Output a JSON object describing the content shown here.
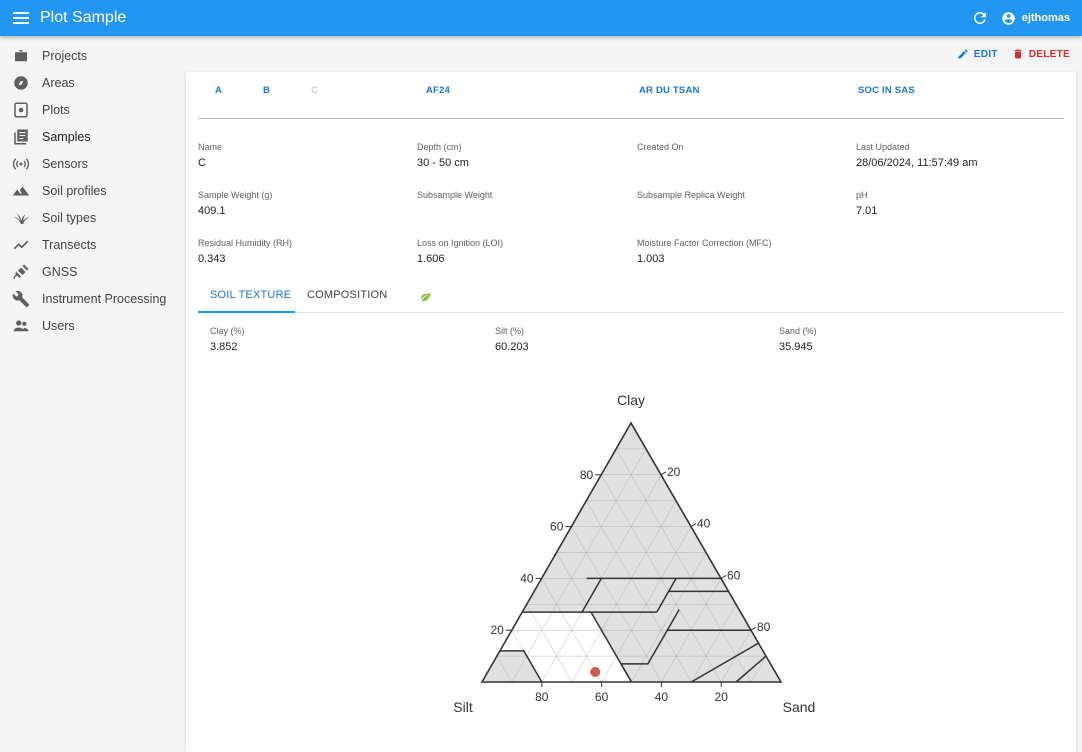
{
  "appbar": {
    "title": "Plot Sample",
    "user": "ejthomas"
  },
  "sidebar": {
    "items": [
      {
        "label": "Projects",
        "icon": "briefcase-icon"
      },
      {
        "label": "Areas",
        "icon": "compass-icon"
      },
      {
        "label": "Plots",
        "icon": "plot-icon"
      },
      {
        "label": "Samples",
        "icon": "samples-icon"
      },
      {
        "label": "Sensors",
        "icon": "sensor-icon"
      },
      {
        "label": "Soil profiles",
        "icon": "terrain-icon"
      },
      {
        "label": "Soil types",
        "icon": "grass-icon"
      },
      {
        "label": "Transects",
        "icon": "transect-icon"
      },
      {
        "label": "GNSS",
        "icon": "satellite-icon"
      },
      {
        "label": "Instrument Processing",
        "icon": "wrench-icon"
      },
      {
        "label": "Users",
        "icon": "users-icon"
      }
    ]
  },
  "actions": {
    "edit": "EDIT",
    "delete": "DELETE"
  },
  "top_tabs": [
    "A",
    "B",
    "C",
    "AF24",
    "AR DU TSAN",
    "SOC IN SAS"
  ],
  "fields": {
    "name": {
      "label": "Name",
      "value": "C"
    },
    "depth": {
      "label": "Depth (cm)",
      "value": "30 - 50 cm"
    },
    "created": {
      "label": "Created On",
      "value": ""
    },
    "updated": {
      "label": "Last Updated",
      "value": "28/06/2024, 11:57:49 am"
    },
    "sample_weight": {
      "label": "Sample Weight (g)",
      "value": "409.1"
    },
    "subsample_weight": {
      "label": "Subsample Weight",
      "value": ""
    },
    "subsample_replica": {
      "label": "Subsample Replica Weight",
      "value": ""
    },
    "ph": {
      "label": "pH",
      "value": "7.01"
    },
    "rh": {
      "label": "Residual Humidity (RH)",
      "value": "0.343"
    },
    "loi": {
      "label": "Loss on Ignition (LOI)",
      "value": "1.606"
    },
    "mfc": {
      "label": "Moisture Factor Correction (MFC)",
      "value": "1.003"
    }
  },
  "sub_tabs": {
    "texture": "SOIL TEXTURE",
    "composition": "COMPOSITION"
  },
  "texture": {
    "clay": {
      "label": "Clay (%)",
      "value": "3.852"
    },
    "silt": {
      "label": "Silt (%)",
      "value": "60.203"
    },
    "sand": {
      "label": "Sand (%)",
      "value": "35.945"
    }
  },
  "chart_data": {
    "type": "scatter",
    "subtype": "ternary",
    "apex_labels": {
      "top": "Clay",
      "left": "Silt",
      "right": "Sand"
    },
    "left_edge_ticks": [
      "20",
      "40",
      "60",
      "80"
    ],
    "right_edge_ticks": [
      "20",
      "40",
      "60",
      "80"
    ],
    "bottom_edge_ticks": [
      "80",
      "60",
      "40",
      "20"
    ],
    "point": {
      "clay": 3.852,
      "silt": 60.203,
      "sand": 35.945,
      "color": "#cd5c4e"
    },
    "colors": {
      "fill": "#e0e0e0",
      "highlight": "#ffffff",
      "grid": "#9e9e9e",
      "boundary": "#333333"
    }
  }
}
